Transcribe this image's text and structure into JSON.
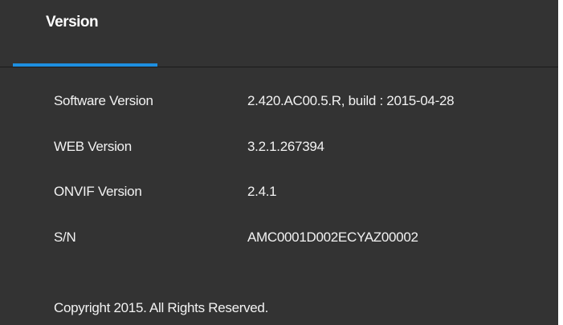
{
  "tabs": [
    {
      "label": "Version",
      "active": true
    }
  ],
  "colors": {
    "background": "#333333",
    "accent": "#1e8fe0",
    "text": "#f2f2f2"
  },
  "version_info": [
    {
      "label": "Software Version",
      "value": "2.420.AC00.5.R, build : 2015-04-28"
    },
    {
      "label": "WEB Version",
      "value": "3.2.1.267394"
    },
    {
      "label": "ONVIF Version",
      "value": "2.4.1"
    },
    {
      "label": "S/N",
      "value": "AMC0001D002ECYAZ00002"
    }
  ],
  "footer": {
    "copyright": "Copyright 2015. All Rights Reserved."
  }
}
